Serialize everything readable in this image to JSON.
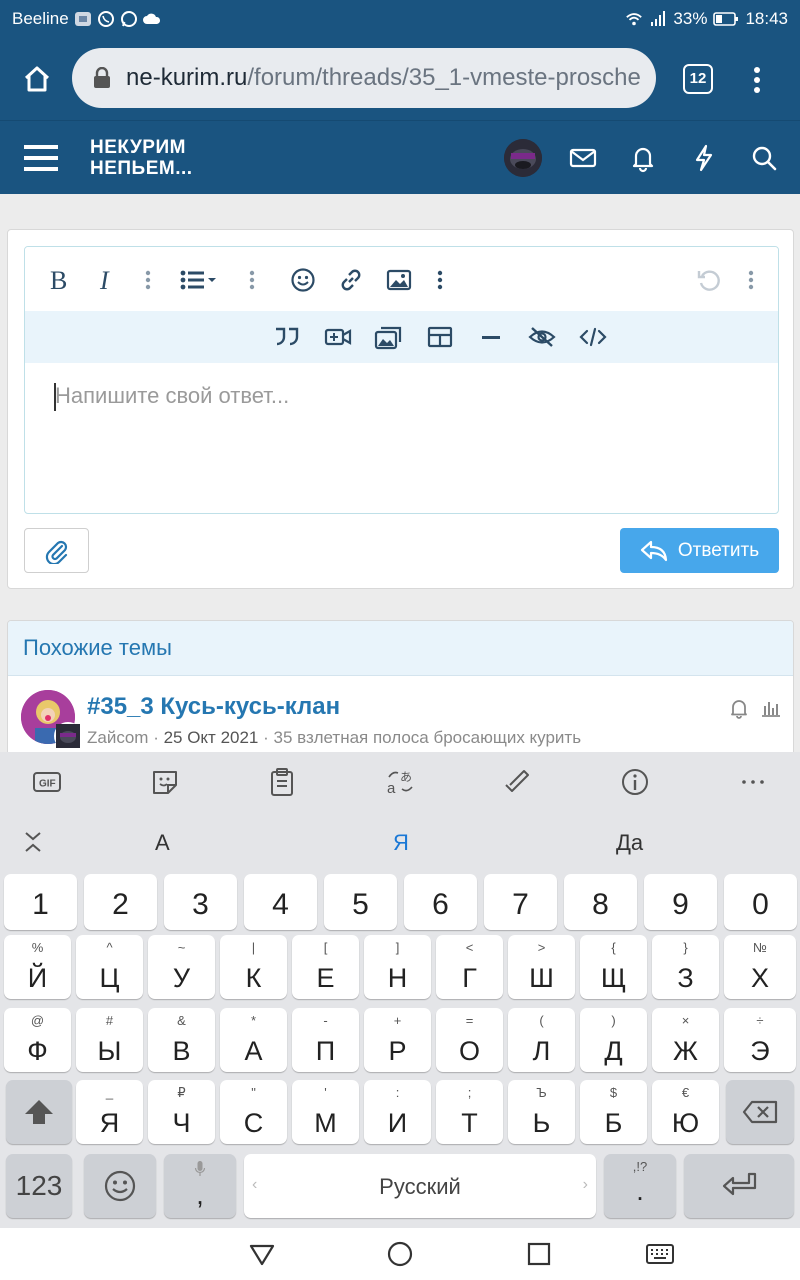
{
  "status_bar": {
    "carrier": "Beeline",
    "battery": "33%",
    "time": "18:43"
  },
  "browser": {
    "url_host": "ne-kurim.ru",
    "url_path": "/forum/threads/35_1-vmeste-prosche",
    "tab_count": "12"
  },
  "site_header": {
    "logo_line1": "НЕКУРИМ",
    "logo_line2": "НЕПЬЕМ..."
  },
  "editor": {
    "placeholder": "Напишите свой ответ...",
    "reply_label": "Ответить"
  },
  "similar": {
    "title": "Похожие темы",
    "thread": {
      "title": "#35_3 Кусь-кусь-клан",
      "author": "Zайcom",
      "date": "25 Окт 2021",
      "forum": "35 взлетная полоса бросающих курить"
    }
  },
  "keyboard": {
    "suggestions": [
      "А",
      "Я",
      "Да"
    ],
    "number_row": [
      "1",
      "2",
      "3",
      "4",
      "5",
      "6",
      "7",
      "8",
      "9",
      "0"
    ],
    "row1": [
      {
        "main": "Й",
        "sub": "%"
      },
      {
        "main": "Ц",
        "sub": "^"
      },
      {
        "main": "У",
        "sub": "~"
      },
      {
        "main": "К",
        "sub": "|"
      },
      {
        "main": "Е",
        "sub": "["
      },
      {
        "main": "Н",
        "sub": "]"
      },
      {
        "main": "Г",
        "sub": "<"
      },
      {
        "main": "Ш",
        "sub": ">"
      },
      {
        "main": "Щ",
        "sub": "{"
      },
      {
        "main": "З",
        "sub": "}"
      },
      {
        "main": "Х",
        "sub": "№"
      }
    ],
    "row2": [
      {
        "main": "Ф",
        "sub": "@"
      },
      {
        "main": "Ы",
        "sub": "#"
      },
      {
        "main": "В",
        "sub": "&"
      },
      {
        "main": "А",
        "sub": "*"
      },
      {
        "main": "П",
        "sub": "-"
      },
      {
        "main": "Р",
        "sub": "+"
      },
      {
        "main": "О",
        "sub": "="
      },
      {
        "main": "Л",
        "sub": "("
      },
      {
        "main": "Д",
        "sub": ")"
      },
      {
        "main": "Ж",
        "sub": "×"
      },
      {
        "main": "Э",
        "sub": "÷"
      }
    ],
    "row3": [
      {
        "main": "Я",
        "sub": "_"
      },
      {
        "main": "Ч",
        "sub": "₽"
      },
      {
        "main": "С",
        "sub": "\""
      },
      {
        "main": "М",
        "sub": "'"
      },
      {
        "main": "И",
        "sub": ":"
      },
      {
        "main": "Т",
        "sub": ";"
      },
      {
        "main": "Ь",
        "sub": "Ъ"
      },
      {
        "main": "Б",
        "sub": "$"
      },
      {
        "main": "Ю",
        "sub": "€"
      }
    ],
    "symbols_label": "123",
    "comma": ",",
    "space_label": "Русский",
    "period": ".",
    "period_sub": ",!?"
  }
}
